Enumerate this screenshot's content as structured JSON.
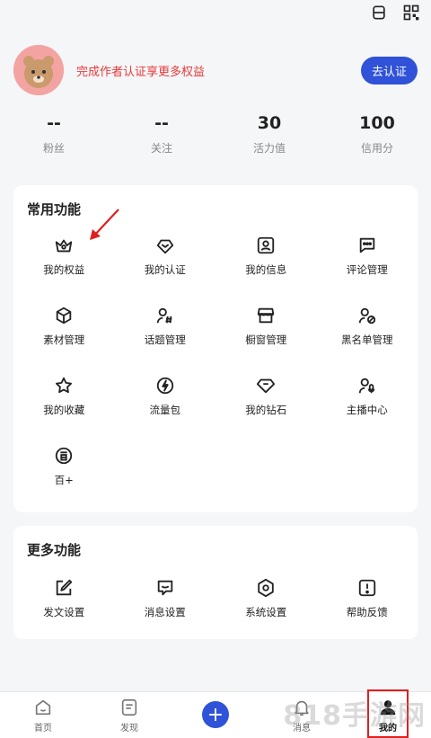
{
  "header": {
    "icons": [
      "scan-icon",
      "qr-code-icon"
    ]
  },
  "profile": {
    "promo_text": "完成作者认证享更多权益",
    "verify_button": "去认证"
  },
  "stats": [
    {
      "value": "--",
      "label": "粉丝"
    },
    {
      "value": "--",
      "label": "关注"
    },
    {
      "value": "30",
      "label": "活力值"
    },
    {
      "value": "100",
      "label": "信用分"
    }
  ],
  "common": {
    "title": "常用功能",
    "items": [
      {
        "label": "我的权益",
        "icon": "crown-icon"
      },
      {
        "label": "我的认证",
        "icon": "verify-icon"
      },
      {
        "label": "我的信息",
        "icon": "user-card-icon"
      },
      {
        "label": "评论管理",
        "icon": "comment-icon"
      },
      {
        "label": "素材管理",
        "icon": "cube-icon"
      },
      {
        "label": "话题管理",
        "icon": "topic-icon"
      },
      {
        "label": "橱窗管理",
        "icon": "shop-icon"
      },
      {
        "label": "黑名单管理",
        "icon": "block-user-icon"
      },
      {
        "label": "我的收藏",
        "icon": "star-icon"
      },
      {
        "label": "流量包",
        "icon": "lightning-icon"
      },
      {
        "label": "我的钻石",
        "icon": "diamond-icon"
      },
      {
        "label": "主播中心",
        "icon": "mic-user-icon"
      },
      {
        "label": "百+",
        "icon": "baijia-icon"
      }
    ]
  },
  "more": {
    "title": "更多功能",
    "items": [
      {
        "label": "发文设置",
        "icon": "edit-icon"
      },
      {
        "label": "消息设置",
        "icon": "message-icon"
      },
      {
        "label": "系统设置",
        "icon": "settings-icon"
      },
      {
        "label": "帮助反馈",
        "icon": "help-icon"
      }
    ]
  },
  "tabbar": [
    {
      "label": "首页",
      "icon": "home-icon"
    },
    {
      "label": "发现",
      "icon": "discover-icon"
    },
    {
      "label": "",
      "icon": "plus-icon"
    },
    {
      "label": "消息",
      "icon": "bell-icon"
    },
    {
      "label": "我的",
      "icon": "person-icon"
    }
  ],
  "colors": {
    "accent": "#2f52d8",
    "promo": "#e83a3a",
    "highlight": "#e01f1f"
  },
  "watermark": "818手游网"
}
